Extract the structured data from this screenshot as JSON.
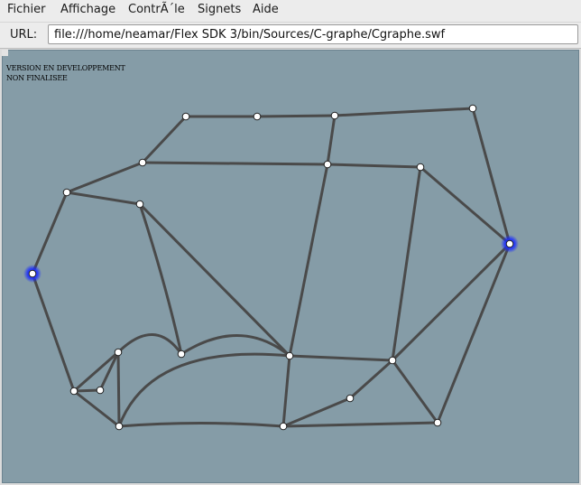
{
  "menu": [
    {
      "id": "fichier",
      "label": "Fichier"
    },
    {
      "id": "affichage",
      "label": "Affichage"
    },
    {
      "id": "controle",
      "label": "ContrÃ´le"
    },
    {
      "id": "signets",
      "label": "Signets"
    },
    {
      "id": "aide",
      "label": "Aide"
    }
  ],
  "urlbar": {
    "label": "URL:",
    "value": "file:///home/neamar/Flex SDK 3/bin/Sources/C-graphe/Cgraphe.swf"
  },
  "stage": {
    "notice_line1": "VERSION EN DEVELOPPEMENT",
    "notice_line2": "NON FINALISEE",
    "background": "#859ca7",
    "edge_color": "#4a4a4a",
    "node_color": "#ffffff",
    "highlight_color": "#1a2cff"
  }
}
